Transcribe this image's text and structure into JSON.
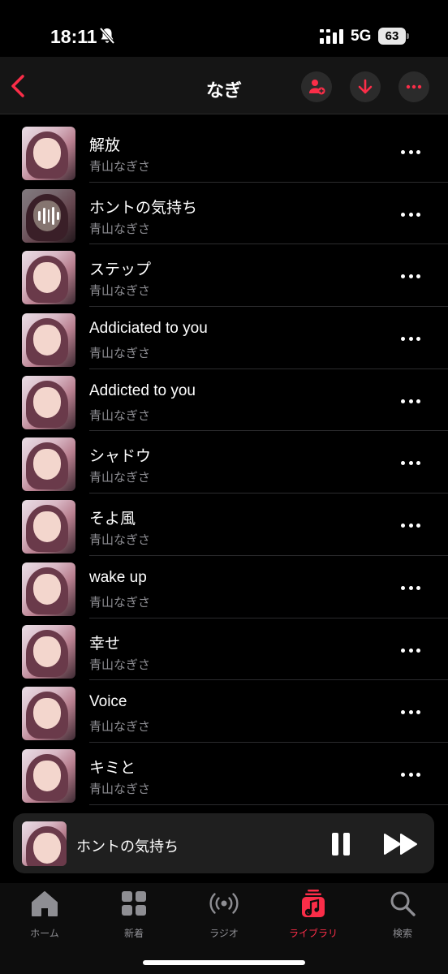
{
  "status": {
    "time": "18:11",
    "network": "5G",
    "battery": "63"
  },
  "header": {
    "title": "なぎ"
  },
  "colors": {
    "accent": "#fa2d48",
    "background": "#000000",
    "secondary_text": "#8e8e93"
  },
  "songs": [
    {
      "title": "解放",
      "artist": "青山なぎさ"
    },
    {
      "title": "ホントの気持ち",
      "artist": "青山なぎさ",
      "playing": true
    },
    {
      "title": "ステップ",
      "artist": "青山なぎさ"
    },
    {
      "title": "Addiciated to you",
      "artist": "青山なぎさ"
    },
    {
      "title": "Addicted to you",
      "artist": "青山なぎさ"
    },
    {
      "title": "シャドウ",
      "artist": "青山なぎさ"
    },
    {
      "title": "そよ風",
      "artist": "青山なぎさ"
    },
    {
      "title": "wake up",
      "artist": "青山なぎさ"
    },
    {
      "title": "幸せ",
      "artist": "青山なぎさ"
    },
    {
      "title": "Voice",
      "artist": "青山なぎさ"
    },
    {
      "title": "キミと",
      "artist": "青山なぎさ"
    }
  ],
  "now_playing": {
    "title": "ホントの気持ち"
  },
  "tabs": [
    {
      "label": "ホーム",
      "icon": "home-icon"
    },
    {
      "label": "新着",
      "icon": "grid-icon"
    },
    {
      "label": "ラジオ",
      "icon": "radio-icon"
    },
    {
      "label": "ライブラリ",
      "icon": "library-icon",
      "active": true
    },
    {
      "label": "検索",
      "icon": "search-icon"
    }
  ]
}
